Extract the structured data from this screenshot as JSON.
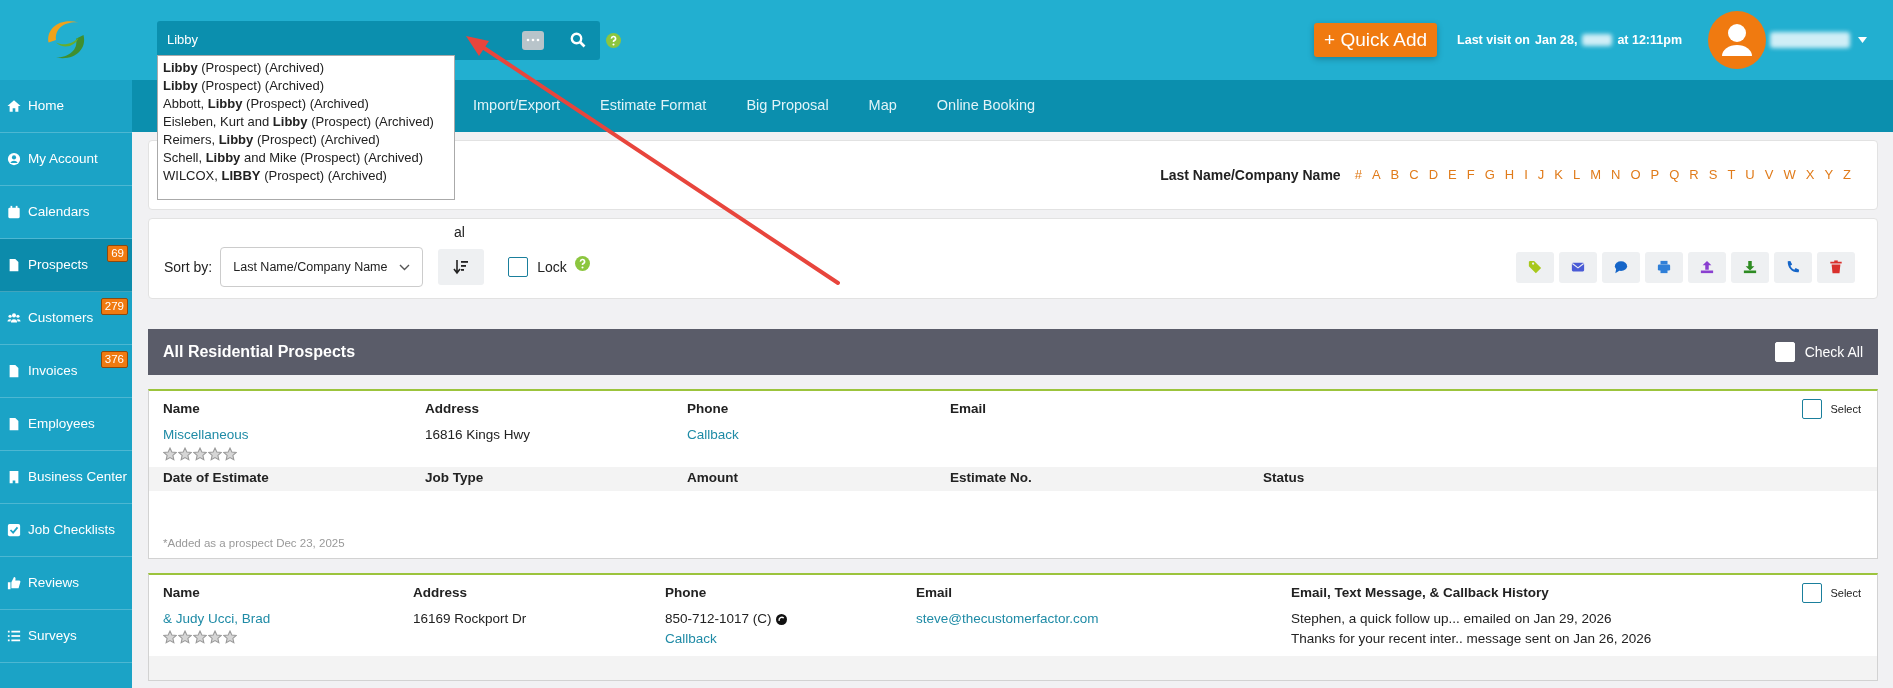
{
  "search": {
    "value": "Libby",
    "suggestions": [
      {
        "text": "**Libby** (Prospect) (Archived)"
      },
      {
        "text": "**Libby** (Prospect) (Archived)"
      },
      {
        "text": "Abbott, **Libby** (Prospect) (Archived)"
      },
      {
        "text": "Eisleben, Kurt and **Libby** (Prospect) (Archived)"
      },
      {
        "text": "Reimers, **Libby** (Prospect) (Archived)"
      },
      {
        "text": "Schell, **Libby** and Mike (Prospect) (Archived)"
      },
      {
        "text": "WILCOX, **LIBBY** (Prospect) (Archived)"
      }
    ]
  },
  "quick_add": "+ Quick Add",
  "last_visit": {
    "label": "Last visit on",
    "date": "Jan 28,",
    "time": "at 12:11pm"
  },
  "sidebar": {
    "items": [
      {
        "label": "Home",
        "kind": "home",
        "selected": false
      },
      {
        "label": "My Account",
        "kind": "user",
        "selected": false
      },
      {
        "label": "Calendars",
        "kind": "calendar",
        "selected": false
      },
      {
        "label": "Prospects",
        "kind": "file",
        "badge": "69",
        "selected": true
      },
      {
        "label": "Customers",
        "kind": "users",
        "badge": "279",
        "selected": false
      },
      {
        "label": "Invoices",
        "kind": "file",
        "badge": "376",
        "selected": false
      },
      {
        "label": "Employees",
        "kind": "file",
        "selected": false
      },
      {
        "label": "Business Center",
        "kind": "building",
        "selected": false
      },
      {
        "label": "Job Checklists",
        "kind": "check",
        "selected": false
      },
      {
        "label": "Reviews",
        "kind": "thumb",
        "selected": false
      },
      {
        "label": "Surveys",
        "kind": "list",
        "selected": false
      }
    ]
  },
  "nav": {
    "items": [
      "Import/Export",
      "Estimate Format",
      "Big Proposal",
      "Map",
      "Online Booking"
    ]
  },
  "letter_filter": {
    "label": "Last Name/Company Name",
    "letters": [
      "#",
      "A",
      "B",
      "C",
      "D",
      "E",
      "F",
      "G",
      "H",
      "I",
      "J",
      "K",
      "L",
      "M",
      "N",
      "O",
      "P",
      "Q",
      "R",
      "S",
      "T",
      "U",
      "V",
      "W",
      "X",
      "Y",
      "Z"
    ]
  },
  "toolbar": {
    "fragment": "al",
    "sort_label": "Sort by:",
    "sort_value": "Last Name/Company Name",
    "lock": {
      "label": "Lock",
      "checked": false
    },
    "actions": [
      {
        "kind": "tag",
        "color": "#a8c81c"
      },
      {
        "kind": "envelope",
        "color": "#4a5bd6"
      },
      {
        "kind": "chat",
        "color": "#1565c8"
      },
      {
        "kind": "printer",
        "color": "#2f7fd8"
      },
      {
        "kind": "upload",
        "color": "#8a3fd0"
      },
      {
        "kind": "download",
        "color": "#2e8b22"
      },
      {
        "kind": "phone",
        "color": "#1565c8"
      },
      {
        "kind": "trash",
        "color": "#d9302c"
      }
    ]
  },
  "section": {
    "title": "All Residential Prospects",
    "check_all": {
      "label": "Check All",
      "checked": false
    }
  },
  "prospects": [
    {
      "headers": [
        "Name",
        "Address",
        "Phone",
        "Email"
      ],
      "name": "Miscellaneous",
      "stars": 0,
      "address": "16816 Kings Hwy",
      "callback": "Callback",
      "select_label": "Select",
      "selected": false,
      "estimate_headers": [
        "Date of Estimate",
        "Job Type",
        "Amount",
        "Estimate No.",
        "Status"
      ],
      "note": "*Added as a prospect Dec 23, 2025"
    },
    {
      "headers": [
        "Name",
        "Address",
        "Phone",
        "Email",
        "Email, Text Message, & Callback History"
      ],
      "name": "& Judy Ucci, Brad",
      "stars": 0,
      "address": "16169 Rockport Dr",
      "phone": [
        "850-712-1017 (C)"
      ],
      "callback": "Callback",
      "email": "steve@thecustomerfactor.com",
      "select_label": "Select",
      "selected": false,
      "history": [
        "Stephen, a quick follow up... emailed on Jan 29, 2026",
        "Thanks for your recent inter.. message sent on Jan 26, 2026"
      ]
    }
  ]
}
